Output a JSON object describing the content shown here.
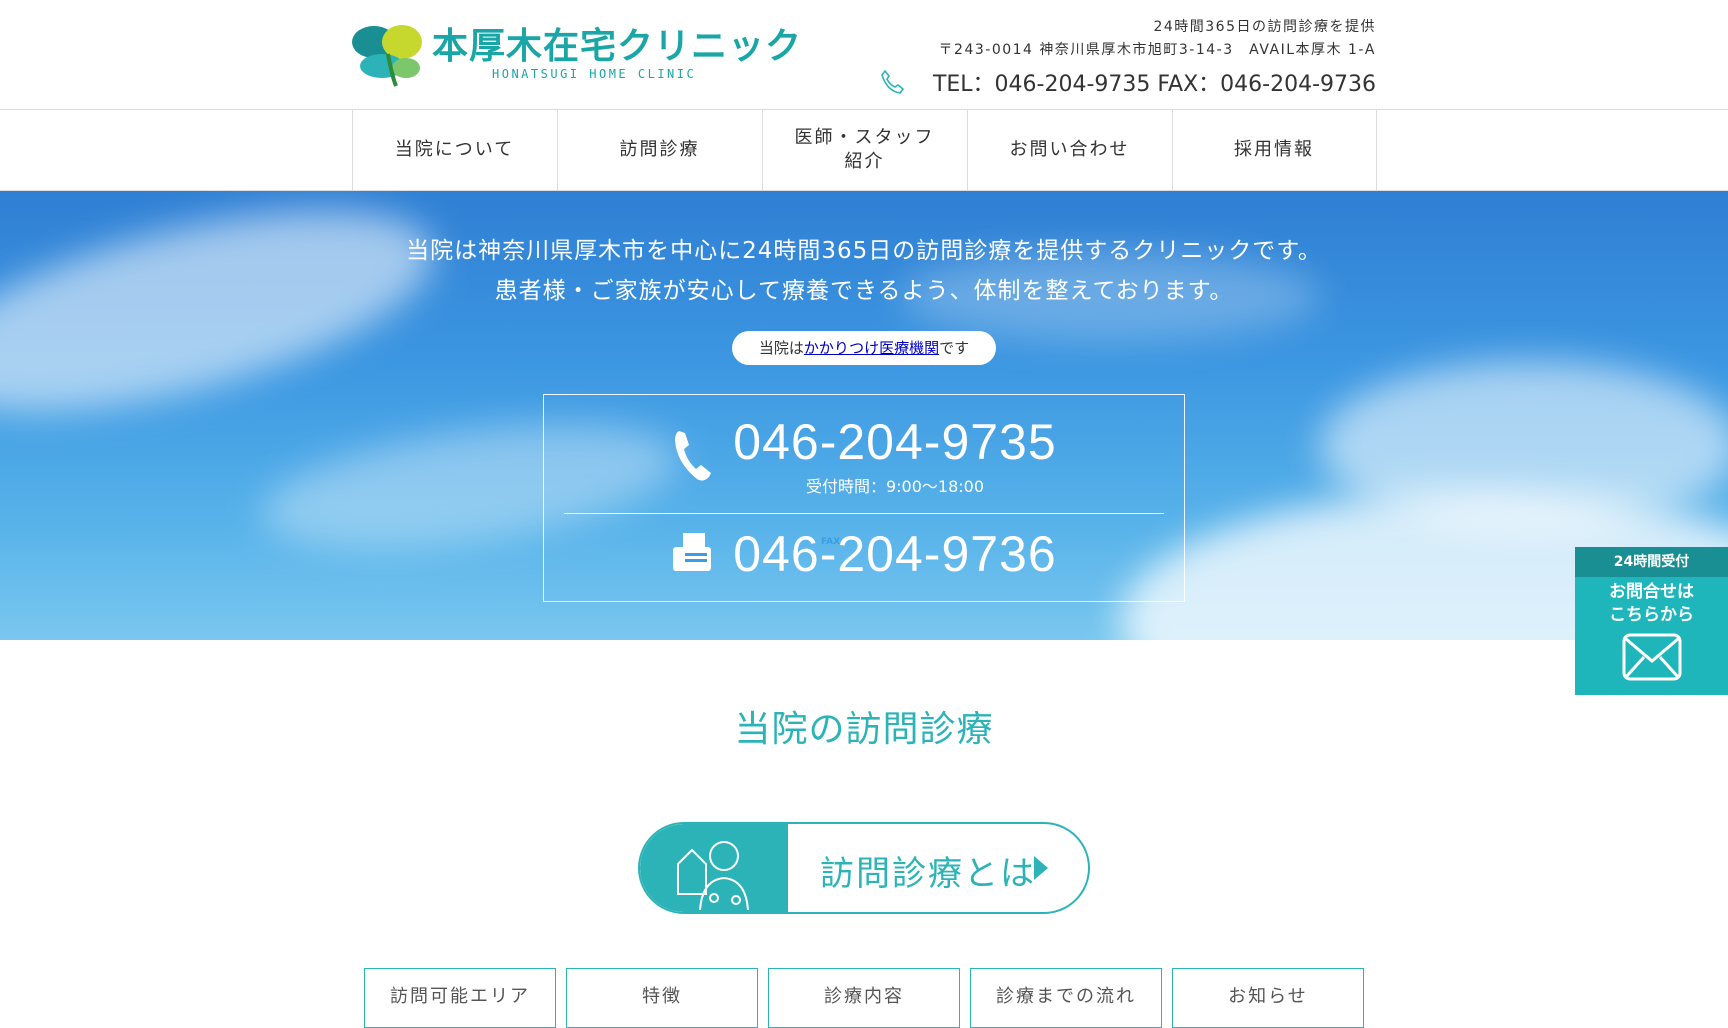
{
  "header": {
    "logo_ja": "本厚木在宅クリニック",
    "logo_en": "HONATSUGI HOME CLINIC",
    "tagline": "24時間365日の訪問診療を提供",
    "address": "〒243-0014 神奈川県厚木市旭町3-14-3　AVAIL本厚木 1-A",
    "tel_line": "TEL：046-204-9735 FAX：046-204-9736"
  },
  "nav": {
    "items": [
      {
        "label": "当院について"
      },
      {
        "label": "訪問診療"
      },
      {
        "label": "医師・スタッフ紹介"
      },
      {
        "label": "お問い合わせ"
      },
      {
        "label": "採用情報"
      }
    ]
  },
  "hero": {
    "lead1": "当院は神奈川県厚木市を中心に24時間365日の訪問診療を提供するクリニックです。",
    "lead2": "患者様・ご家族が安心して療養できるよう、体制を整えております。",
    "pill_prefix": "当院は",
    "pill_link": "かかりつけ医療機関",
    "pill_suffix": "です",
    "tel": "046-204-9735",
    "hours": "受付時間：9:00〜18:00",
    "fax": "046-204-9736",
    "fax_badge": "FAX"
  },
  "main": {
    "section_title": "当院の訪問診療",
    "cta_label": "訪問診療とは",
    "subtabs": [
      "訪問可能エリア",
      "特徴",
      "診療内容",
      "診療までの流れ",
      "お知らせ"
    ]
  },
  "side_button": {
    "top": "24時間受付",
    "line1": "お問合せは",
    "line2": "こちらから"
  },
  "colors": {
    "brand": "#2bb3b8",
    "sky_top": "#2f7fd4",
    "sky_bottom": "#79c7ef"
  }
}
